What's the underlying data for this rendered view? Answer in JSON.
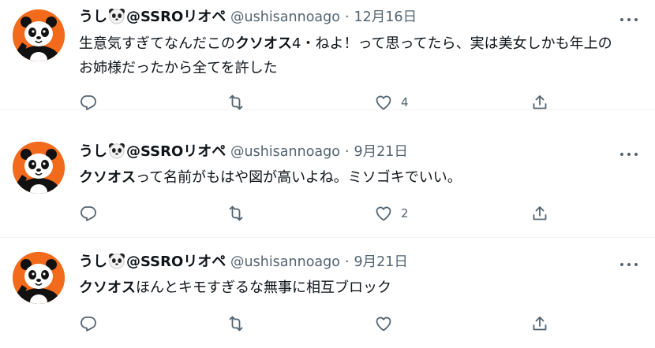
{
  "tweets": [
    {
      "display_name": "うし",
      "name_suffix": "@SSROリオペ",
      "handle": "@ushisannoago",
      "separator": "·",
      "date": "12月16日",
      "text_before": "生意気すぎてなんだこの",
      "text_bold": "クソオス",
      "text_after": "4・ねよ！って思ってたら、実は美女しかも年上のお姉様だったから全てを許した",
      "likes": "4"
    },
    {
      "display_name": "うし",
      "name_suffix": "@SSROリオペ",
      "handle": "@ushisannoago",
      "separator": "·",
      "date": "9月21日",
      "text_before": "",
      "text_bold": "クソオス",
      "text_after": "って名前がもはや図が高いよね。ミソゴキでいい。",
      "likes": "2"
    },
    {
      "display_name": "うし",
      "name_suffix": "@SSROリオペ",
      "handle": "@ushisannoago",
      "separator": "·",
      "date": "9月21日",
      "text_before": "",
      "text_bold": "クソオス",
      "text_after": "ほんとキモすぎるな無事に相互ブロック",
      "likes": ""
    }
  ],
  "icons": {
    "avatar": "panda-avatar",
    "emoji": "panda-face-emoji",
    "more": "more-horizontal-icon",
    "reply": "reply-icon",
    "retweet": "retweet-icon",
    "like": "heart-icon",
    "share": "share-icon"
  },
  "colors": {
    "avatar_bg": "#f26b1d",
    "text": "#0f1419",
    "muted": "#536471",
    "divider": "#eff3f4"
  }
}
